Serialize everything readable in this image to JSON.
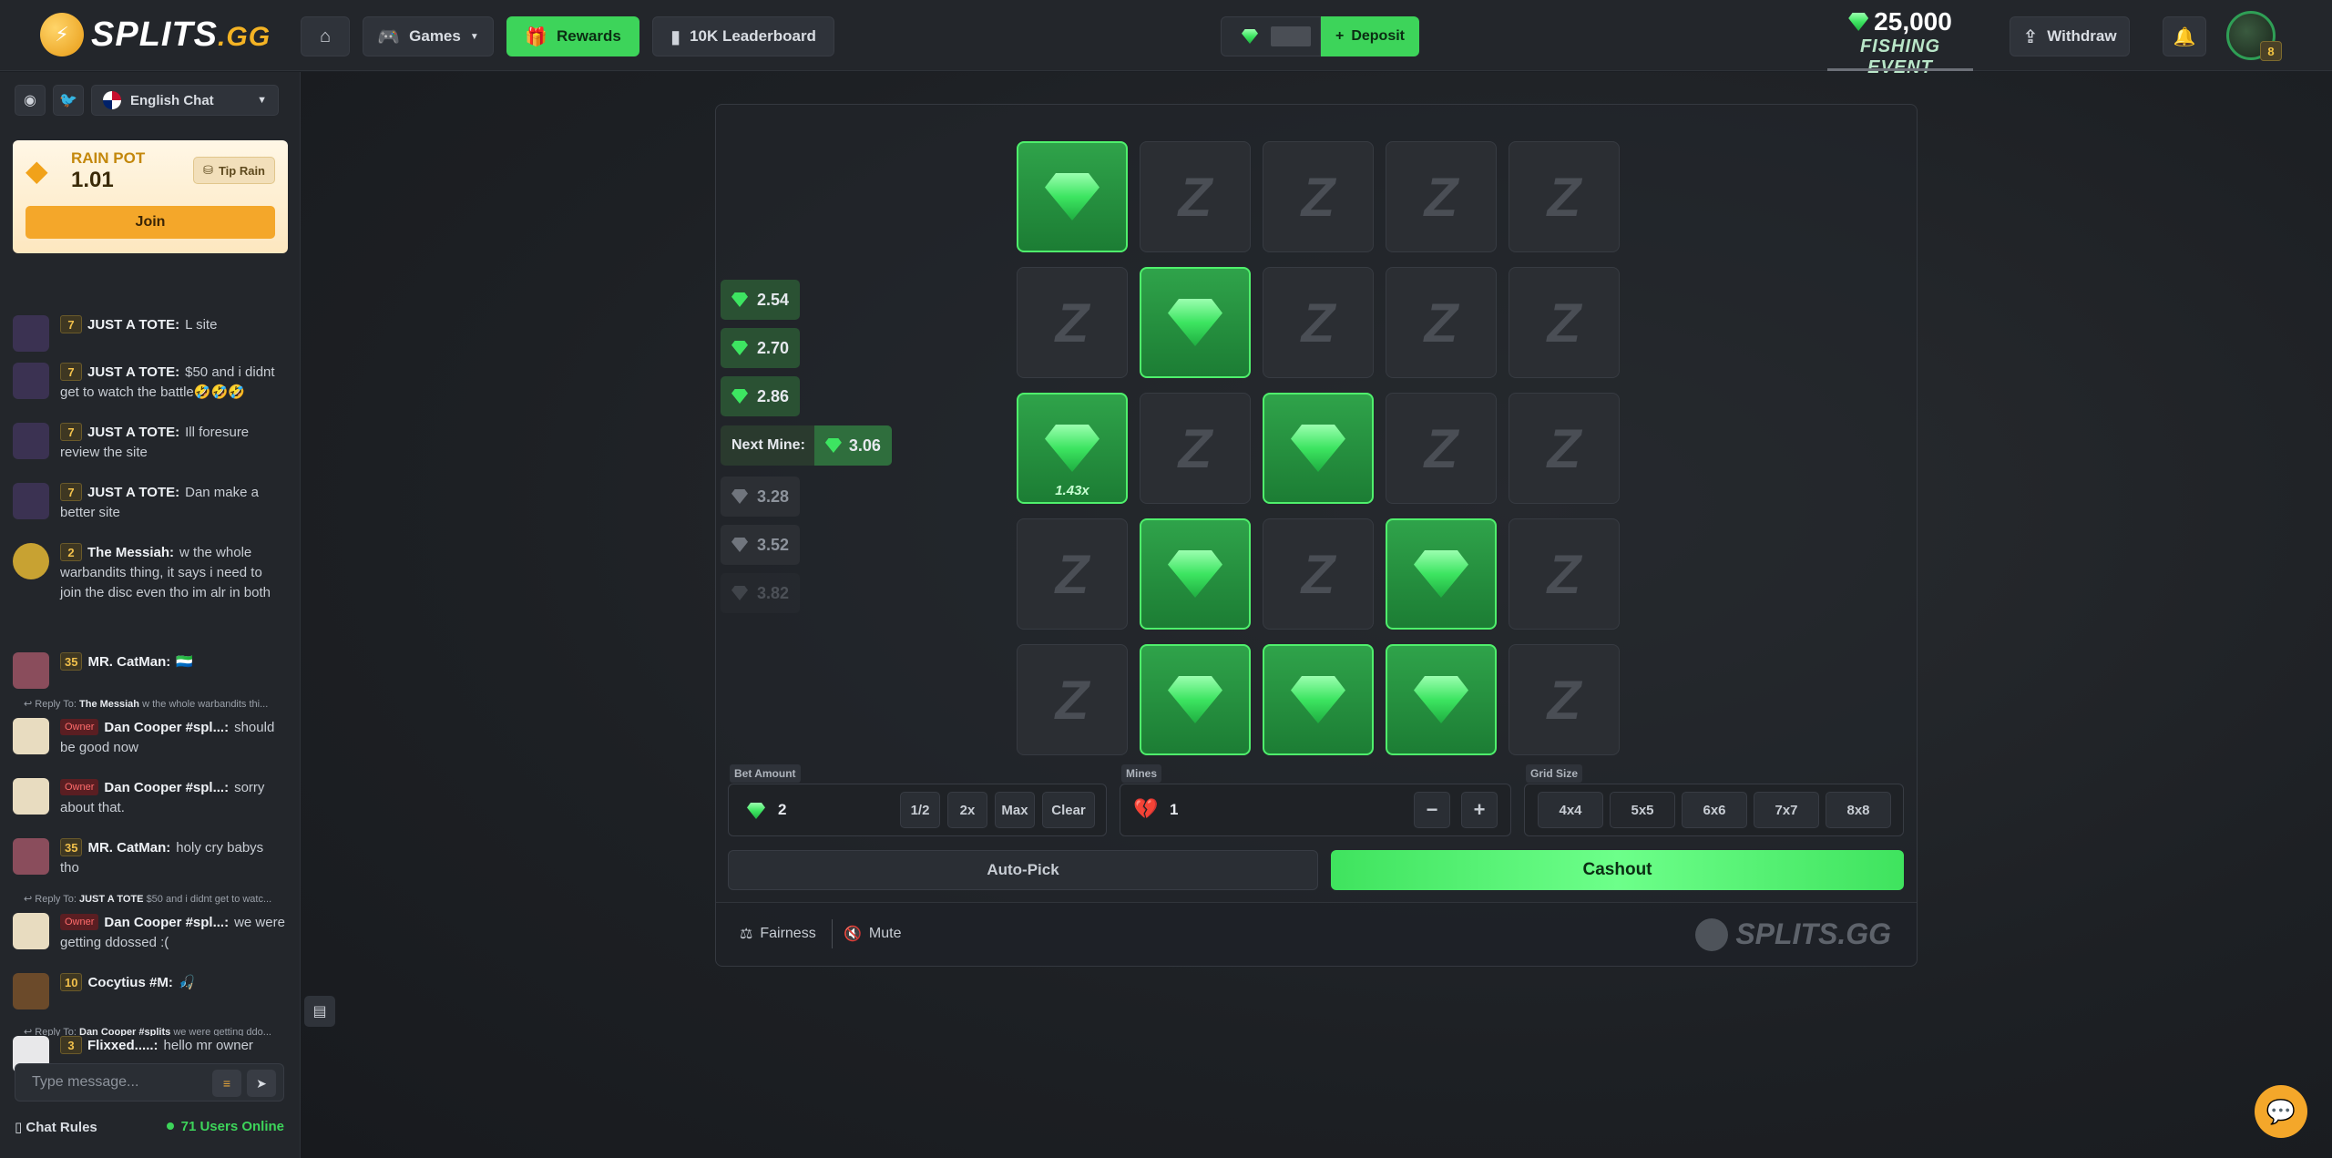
{
  "header": {
    "logo_main": "SPLITS",
    "logo_suffix": ".GG",
    "nav": {
      "games": "Games",
      "rewards": "Rewards",
      "leaderboard": "10K Leaderboard"
    },
    "deposit": "Deposit",
    "event": {
      "amount": "25,000",
      "label": "FISHING EVENT"
    },
    "withdraw": "Withdraw",
    "avatar_level": "8"
  },
  "sidebar": {
    "language": "English Chat",
    "rain": {
      "title": "RAIN POT",
      "value": "1.01",
      "tip": "Tip Rain",
      "join": "Join"
    },
    "messages": [
      {
        "level": "7",
        "name": "JUST A TOTE:",
        "text": "L site"
      },
      {
        "level": "7",
        "name": "JUST A TOTE:",
        "text": "$50 and i didnt get to watch the battle🤣🤣🤣"
      },
      {
        "level": "7",
        "name": "JUST A TOTE:",
        "text": "Ill foresure review the site"
      },
      {
        "level": "7",
        "name": "JUST A TOTE:",
        "text": "Dan make a better site"
      },
      {
        "level": "2",
        "name": "The Messiah:",
        "text": "w the whole warbandits thing, it says i need to join the disc even tho im alr in both"
      },
      {
        "level": "35",
        "name": "MR. CatMan:",
        "text": "🇸🇱"
      },
      {
        "reply_prefix": "Reply To:",
        "reply_name": "The Messiah",
        "reply_text": "w the whole warbandits thi..."
      },
      {
        "badge": "Owner",
        "name": "Dan Cooper #spl...:",
        "text": "should be good now"
      },
      {
        "badge": "Owner",
        "name": "Dan Cooper #spl...:",
        "text": "sorry about that."
      },
      {
        "level": "35",
        "name": "MR. CatMan:",
        "text": "holy cry babys tho"
      },
      {
        "reply_prefix": "Reply To:",
        "reply_name": "JUST A TOTE",
        "reply_text": "$50 and i didnt get to watc..."
      },
      {
        "badge": "Owner",
        "name": "Dan Cooper #spl...:",
        "text": "we were getting ddossed :("
      },
      {
        "level": "10",
        "name": "Cocytius #M:",
        "text": "🎣"
      },
      {
        "reply_prefix": "Reply To:",
        "reply_name": "Dan Cooper #splits",
        "reply_text": "we were getting ddo..."
      },
      {
        "level": "3",
        "name": "Flixxed.....:",
        "text": "hello mr owner"
      }
    ],
    "input_placeholder": "Type message...",
    "chat_rules": "Chat Rules",
    "online": "71 Users Online"
  },
  "game": {
    "multipliers": [
      "2.54",
      "2.70",
      "2.86"
    ],
    "next_mine_label": "Next Mine:",
    "next_mine_value": "3.06",
    "upcoming": [
      "3.28",
      "3.52",
      "3.82"
    ],
    "grid": [
      [
        "gem",
        "mine",
        "mine",
        "mine",
        "mine"
      ],
      [
        "mine",
        "gem",
        "mine",
        "mine",
        "mine"
      ],
      [
        "gem",
        "mine",
        "gem",
        "mine",
        "mine"
      ],
      [
        "mine",
        "gem",
        "mine",
        "gem",
        "mine"
      ],
      [
        "mine",
        "gem",
        "gem",
        "gem",
        "mine"
      ]
    ],
    "last_pick_multiplier": "1.43x",
    "bet": {
      "label": "Bet Amount",
      "value": "2",
      "half": "1/2",
      "double": "2x",
      "max": "Max",
      "clear": "Clear"
    },
    "mines": {
      "label": "Mines",
      "value": "1",
      "minus": "−",
      "plus": "+"
    },
    "grid_size": {
      "label": "Grid Size",
      "options": [
        "4x4",
        "5x5",
        "6x6",
        "7x7",
        "8x8"
      ]
    },
    "autopick": "Auto-Pick",
    "cashout": "Cashout",
    "fairness": "Fairness",
    "mute": "Mute",
    "footer_logo": "SPLITS.GG"
  },
  "colors": {
    "accent": "#3dd45a",
    "gold": "#f4a72a",
    "bg": "#1c1f24"
  }
}
